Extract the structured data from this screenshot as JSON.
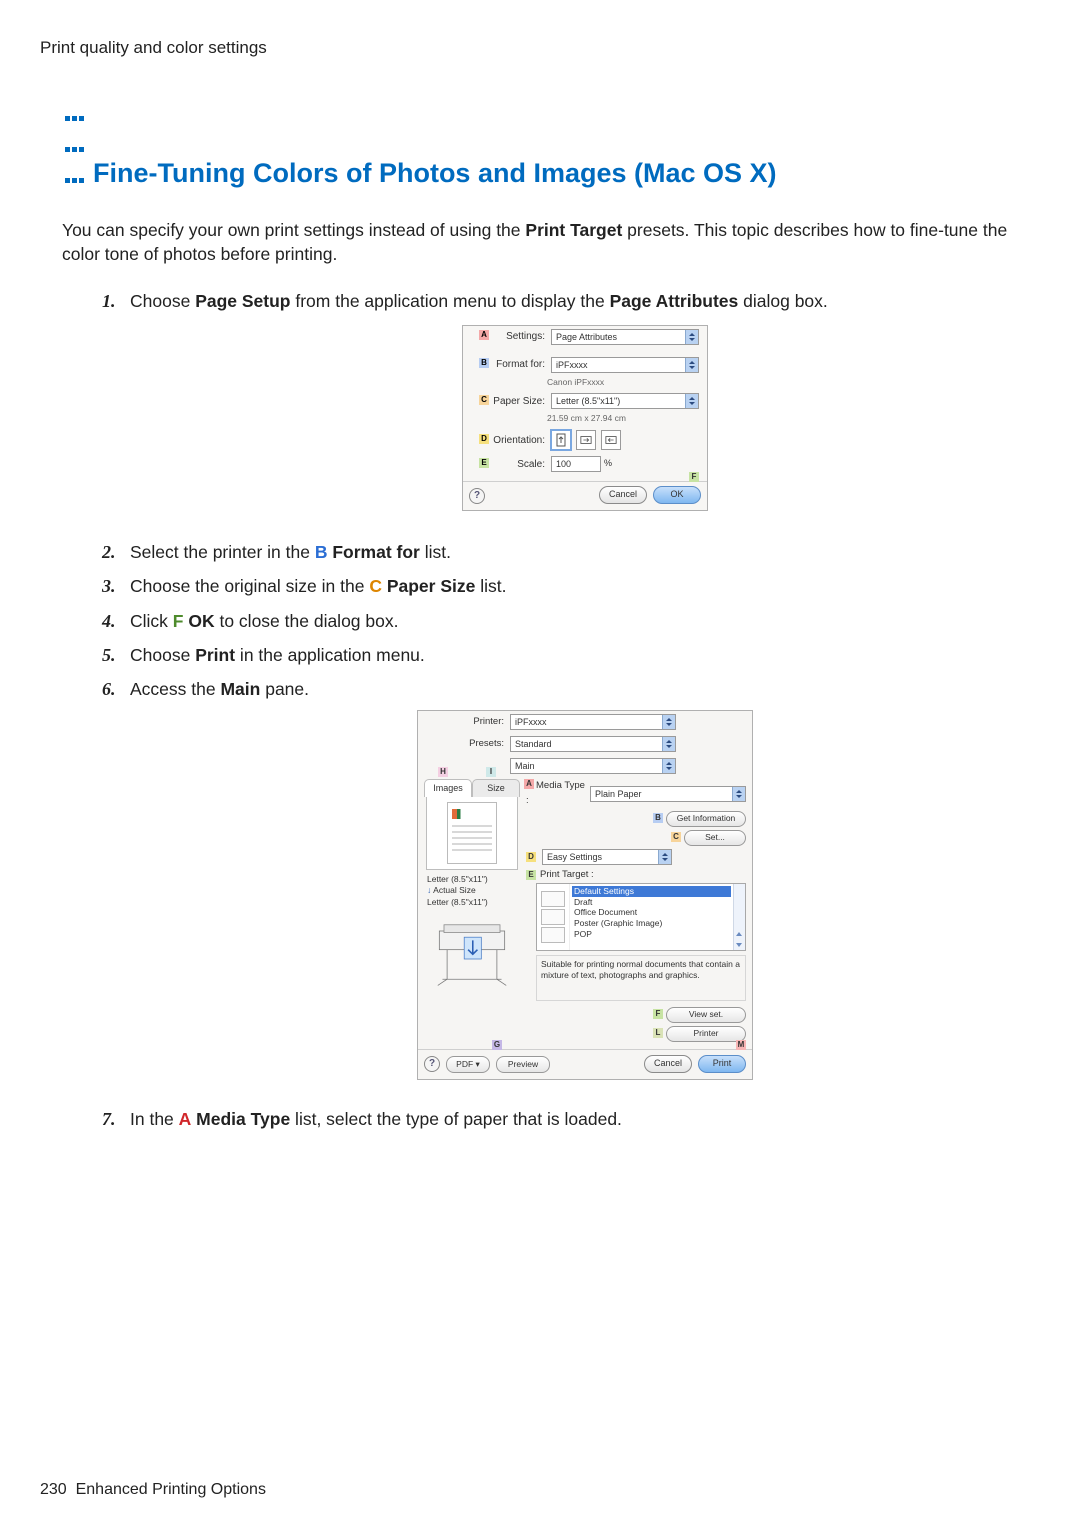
{
  "breadcrumb": "Print quality and color settings",
  "title": "Fine-Tuning Colors of Photos and Images (Mac OS X)",
  "intro": {
    "pre": "You can specify your own print settings instead of using the ",
    "bold1": "Print Target",
    "mid": " presets. This topic describes how to fine-tune the color tone of photos before printing."
  },
  "steps": {
    "s1": {
      "pre": "Choose ",
      "b1": "Page Setup",
      "mid": " from the application menu to display the ",
      "b2": "Page Attributes",
      "post": " dialog box."
    },
    "s2": {
      "pre": "Select the printer in the ",
      "letter": "B",
      "name": "Format for",
      "post": " list."
    },
    "s3": {
      "pre": "Choose the original size in the ",
      "letter": "C",
      "name": "Paper Size",
      "post": " list."
    },
    "s4": {
      "pre": "Click ",
      "letter": "F",
      "name": "OK",
      "post": " to close the dialog box."
    },
    "s5": {
      "pre": "Choose ",
      "b1": "Print",
      "post": " in the application menu."
    },
    "s6": {
      "pre": "Access the ",
      "b1": "Main",
      "post": " pane."
    },
    "s7": {
      "pre": "In the ",
      "letter": "A",
      "name": "Media Type",
      "post": " list, select the type of paper that is loaded."
    }
  },
  "page_setup": {
    "A": {
      "letter": "A",
      "label": "Settings:",
      "value": "Page Attributes"
    },
    "B": {
      "letter": "B",
      "label": "Format for:",
      "value": "iPFxxxx",
      "sub": "Canon iPFxxxx"
    },
    "C": {
      "letter": "C",
      "label": "Paper Size:",
      "value": "Letter (8.5\"x11\")",
      "sub": "21.59 cm x 27.94 cm"
    },
    "D": {
      "letter": "D",
      "label": "Orientation:"
    },
    "E": {
      "letter": "E",
      "label": "Scale:",
      "value": "100",
      "pct": "%"
    },
    "F": {
      "letter": "F"
    },
    "help": "?",
    "cancel": "Cancel",
    "ok": "OK"
  },
  "print": {
    "printer_label": "Printer:",
    "printer_value": "iPFxxxx",
    "presets_label": "Presets:",
    "presets_value": "Standard",
    "pane_value": "Main",
    "tabs": {
      "H": "H",
      "I": "I",
      "images": "Images",
      "size": "Size"
    },
    "info": {
      "l1": "Letter (8.5\"x11\")",
      "l2": "Actual Size",
      "l3": "Letter (8.5\"x11\")"
    },
    "A": {
      "letter": "A",
      "label": "Media Type :",
      "value": "Plain Paper"
    },
    "B": {
      "letter": "B",
      "btn": "Get Information"
    },
    "C": {
      "letter": "C",
      "btn": "Set..."
    },
    "D": {
      "letter": "D",
      "label": "Easy Settings"
    },
    "E": {
      "letter": "E",
      "label": "Print Target :"
    },
    "target_items": [
      "Default Settings",
      "Draft",
      "Office Document",
      "Poster (Graphic Image)",
      "POP"
    ],
    "target_selected_index": 0,
    "desc": "Suitable for printing normal documents that contain a mixture of text, photographs and graphics.",
    "F": {
      "letter": "F",
      "btn": "View set."
    },
    "L": {
      "letter": "L",
      "btn": "Printer"
    },
    "G": {
      "letter": "G"
    },
    "M": {
      "letter": "M"
    },
    "help": "?",
    "pdf": "PDF ▾",
    "preview": "Preview",
    "cancel": "Cancel",
    "print_btn": "Print"
  },
  "footer": {
    "pageno": "230",
    "section": "Enhanced Printing Options"
  }
}
